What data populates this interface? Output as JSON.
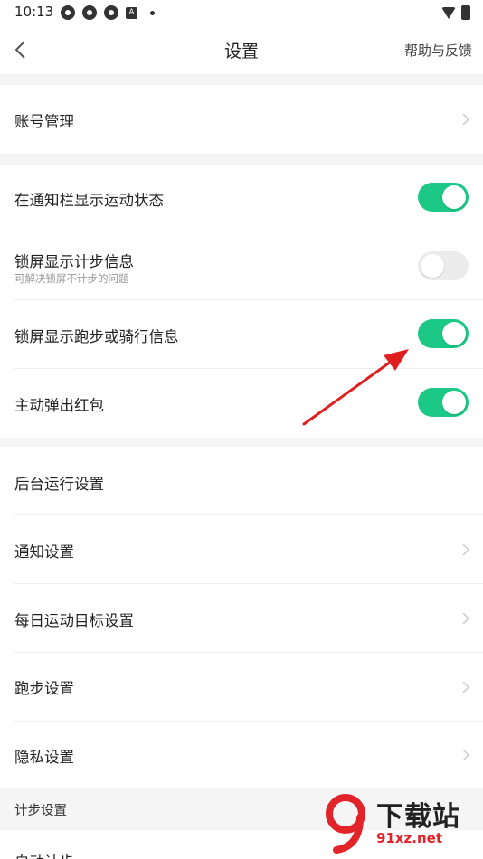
{
  "status_bar": {
    "time": "10:13",
    "left_icons": [
      "app-icon",
      "app-icon",
      "app-icon",
      "a-icon",
      "dot-icon"
    ],
    "right_icons": [
      "wifi-icon",
      "battery-icon"
    ]
  },
  "header": {
    "title": "设置",
    "back_icon": "back-arrow-icon",
    "help_label": "帮助与反馈"
  },
  "rows": {
    "account": {
      "label": "账号管理",
      "icon": "chevron-right-icon"
    },
    "notify_bar": {
      "label": "在通知栏显示运动状态",
      "toggle_on": true
    },
    "lockscreen_steps": {
      "label": "锁屏显示计步信息",
      "sub": "可解决锁屏不计步的问题",
      "toggle_on": false
    },
    "lockscreen_run": {
      "label": "锁屏显示跑步或骑行信息",
      "toggle_on": true
    },
    "red_packet": {
      "label": "主动弹出红包",
      "toggle_on": true
    },
    "background": {
      "label": "后台运行设置"
    },
    "notification": {
      "label": "通知设置",
      "icon": "chevron-right-icon"
    },
    "daily_goal": {
      "label": "每日运动目标设置",
      "icon": "chevron-right-icon"
    },
    "running": {
      "label": "跑步设置",
      "icon": "chevron-right-icon"
    },
    "privacy": {
      "label": "隐私设置",
      "icon": "chevron-right-icon"
    }
  },
  "step_section": {
    "label": "计步设置"
  },
  "bottom_row": {
    "label": "自动计步"
  },
  "annotation": {
    "icon": "red-arrow-icon",
    "color": "#e02020"
  },
  "watermark": {
    "title": "下载站",
    "url": "91xz.net",
    "logo_text": "9",
    "accent": "#e2232a"
  },
  "colors": {
    "accent": "#1cc886",
    "toggle_off": "#ececec",
    "gap": "#f5f5f5"
  }
}
